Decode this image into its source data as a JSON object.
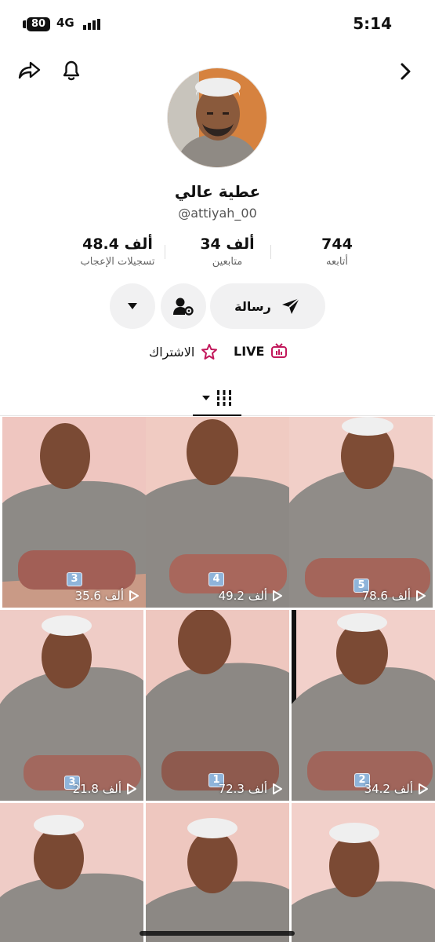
{
  "status_bar": {
    "battery": "80",
    "network": "4G",
    "time": "5:14"
  },
  "icons": {
    "share": "share-icon",
    "notifications": "bell-icon",
    "forward": "chevron-right-icon"
  },
  "profile": {
    "display_name": "عطية عالي",
    "username": "@attiyah_00"
  },
  "stats": {
    "following": {
      "value": "744",
      "label": "أتابعه"
    },
    "followers": {
      "value": "34 ألف",
      "label": "متابعين"
    },
    "likes": {
      "value": "48.4 ألف",
      "label": "تسجيلات الإعجاب"
    }
  },
  "actions": {
    "message_label": "رسالة"
  },
  "links": {
    "live_label": "LIVE",
    "subscribe_label": "الاشتراك"
  },
  "colors": {
    "accent_live": "#c2185b",
    "badge": "#8fb4da",
    "button_bg": "#f1f1f2"
  },
  "videos": [
    {
      "badge": "3",
      "views": "35.6 ألف"
    },
    {
      "badge": "4",
      "views": "49.2 ألف"
    },
    {
      "badge": "5",
      "views": "78.6 ألف"
    },
    {
      "badge": "3",
      "views": "21.8 ألف"
    },
    {
      "badge": "1",
      "views": "72.3 ألف"
    },
    {
      "badge": "2",
      "views": "34.2 ألف"
    },
    {
      "badge": "",
      "views": ""
    },
    {
      "badge": "",
      "views": ""
    },
    {
      "badge": "",
      "views": ""
    }
  ]
}
